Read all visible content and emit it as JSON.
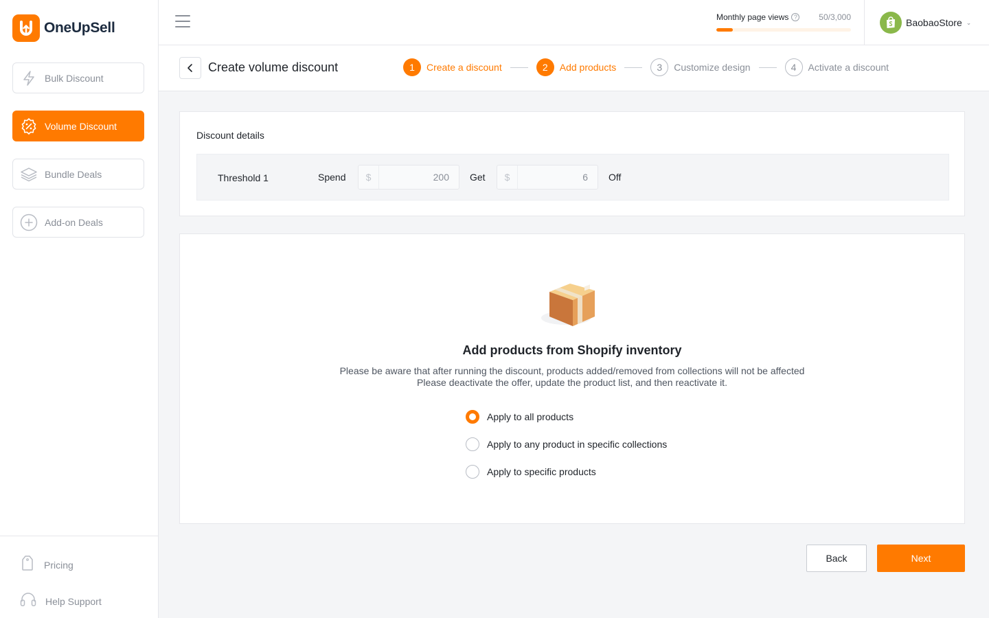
{
  "app": {
    "name": "OneUpSell"
  },
  "sidebar": {
    "items": [
      {
        "label": "Bulk Discount",
        "icon": "lightning-icon",
        "active": false
      },
      {
        "label": "Volume Discount",
        "icon": "discount-badge-icon",
        "active": true
      },
      {
        "label": "Bundle Deals",
        "icon": "layers-icon",
        "active": false
      },
      {
        "label": "Add-on Deals",
        "icon": "plus-circle-icon",
        "active": false
      }
    ],
    "footer": [
      {
        "label": "Pricing",
        "icon": "tag-icon"
      },
      {
        "label": "Help Support",
        "icon": "headset-icon"
      }
    ]
  },
  "topbar": {
    "page_views_label": "Monthly page views",
    "page_views_count": "50/3,000",
    "page_views_fraction": 0.0167,
    "store_name": "BaobaoStore"
  },
  "header": {
    "title": "Create volume discount",
    "steps": [
      {
        "num": "1",
        "label": "Create a discount",
        "done": true
      },
      {
        "num": "2",
        "label": "Add products",
        "done": true
      },
      {
        "num": "3",
        "label": "Customize design",
        "done": false
      },
      {
        "num": "4",
        "label": "Activate a discount",
        "done": false
      }
    ]
  },
  "discount": {
    "title": "Discount details",
    "threshold_name": "Threshold 1",
    "spend_label": "Spend",
    "spend_currency": "$",
    "spend_value": "200",
    "get_label": "Get",
    "get_currency": "$",
    "get_value": "6",
    "off_label": "Off"
  },
  "products": {
    "title": "Add products from Shopify inventory",
    "desc_line1": "Please be aware that after running the discount, products added/removed from collections will not be affected",
    "desc_line2": "Please deactivate the offer, update the product list, and then reactivate it.",
    "options": [
      {
        "label": "Apply to all products",
        "selected": true
      },
      {
        "label": "Apply to any product in specific collections",
        "selected": false
      },
      {
        "label": "Apply to specific products",
        "selected": false
      }
    ]
  },
  "actions": {
    "back_label": "Back",
    "next_label": "Next"
  },
  "colors": {
    "accent": "#ff7a00",
    "shopify_green": "#8ab84a"
  }
}
